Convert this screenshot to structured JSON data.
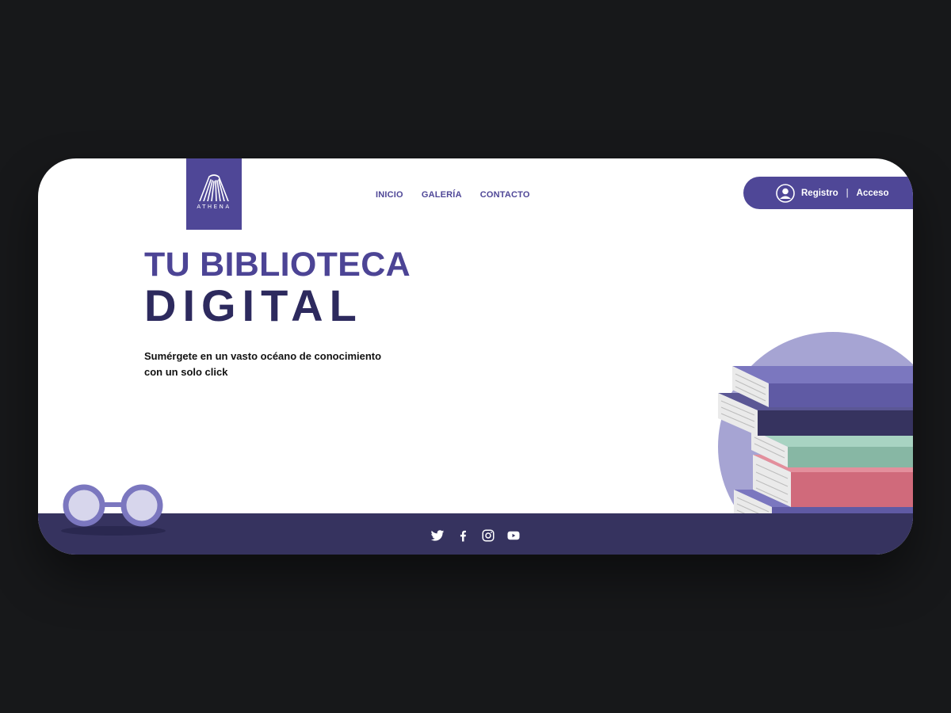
{
  "brand": {
    "name": "ATHENA"
  },
  "nav": {
    "items": [
      "INICIO",
      "GALERÍA",
      "CONTACTO"
    ]
  },
  "auth": {
    "register": "Registro",
    "separator": "|",
    "login": "Acceso"
  },
  "hero": {
    "title_line1": "TU BIBLIOTECA",
    "title_line2": "DIGITAL",
    "subtitle_line1": "Sumérgete en un vasto océano de conocimiento",
    "subtitle_line2": "con un solo click"
  },
  "social": [
    "twitter-icon",
    "facebook-icon",
    "instagram-icon",
    "youtube-icon"
  ],
  "colors": {
    "primary": "#4f4797",
    "dark": "#36335f",
    "background": "#17181a",
    "book_purple": "#5f5aa4",
    "book_green": "#87b7a4",
    "book_pink": "#d06a7b",
    "circle": "#a6a4d3"
  }
}
